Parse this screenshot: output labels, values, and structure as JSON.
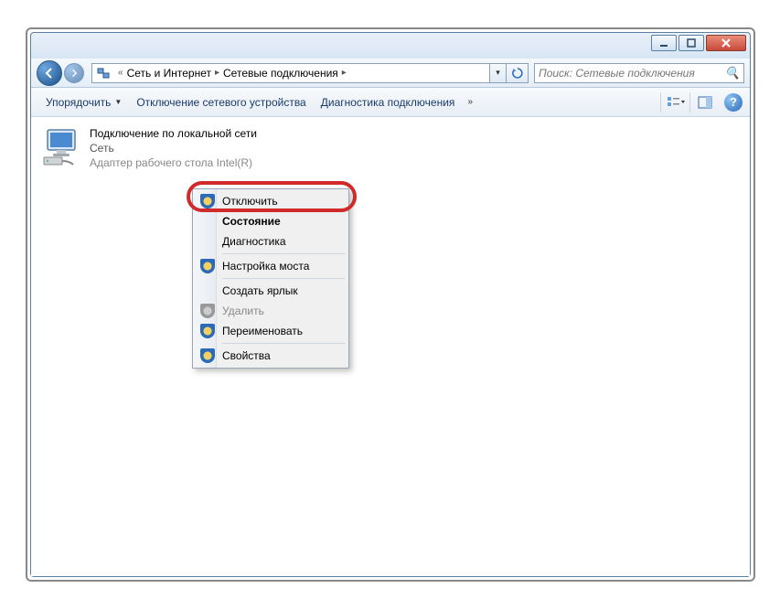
{
  "breadcrumb": {
    "part1": "Сеть и Интернет",
    "part2": "Сетевые подключения"
  },
  "search": {
    "placeholder": "Поиск: Сетевые подключения"
  },
  "toolbar": {
    "organize": "Упорядочить",
    "disable_device": "Отключение сетевого устройства",
    "diagnostics": "Диагностика подключения"
  },
  "connection": {
    "name": "Подключение по локальной сети",
    "network": "Сеть",
    "adapter": "Адаптер рабочего стола Intel(R)"
  },
  "context_menu": {
    "disable": "Отключить",
    "status": "Состояние",
    "diagnostics": "Диагностика",
    "bridge": "Настройка моста",
    "shortcut": "Создать ярлык",
    "delete": "Удалить",
    "rename": "Переименовать",
    "properties": "Свойства"
  }
}
